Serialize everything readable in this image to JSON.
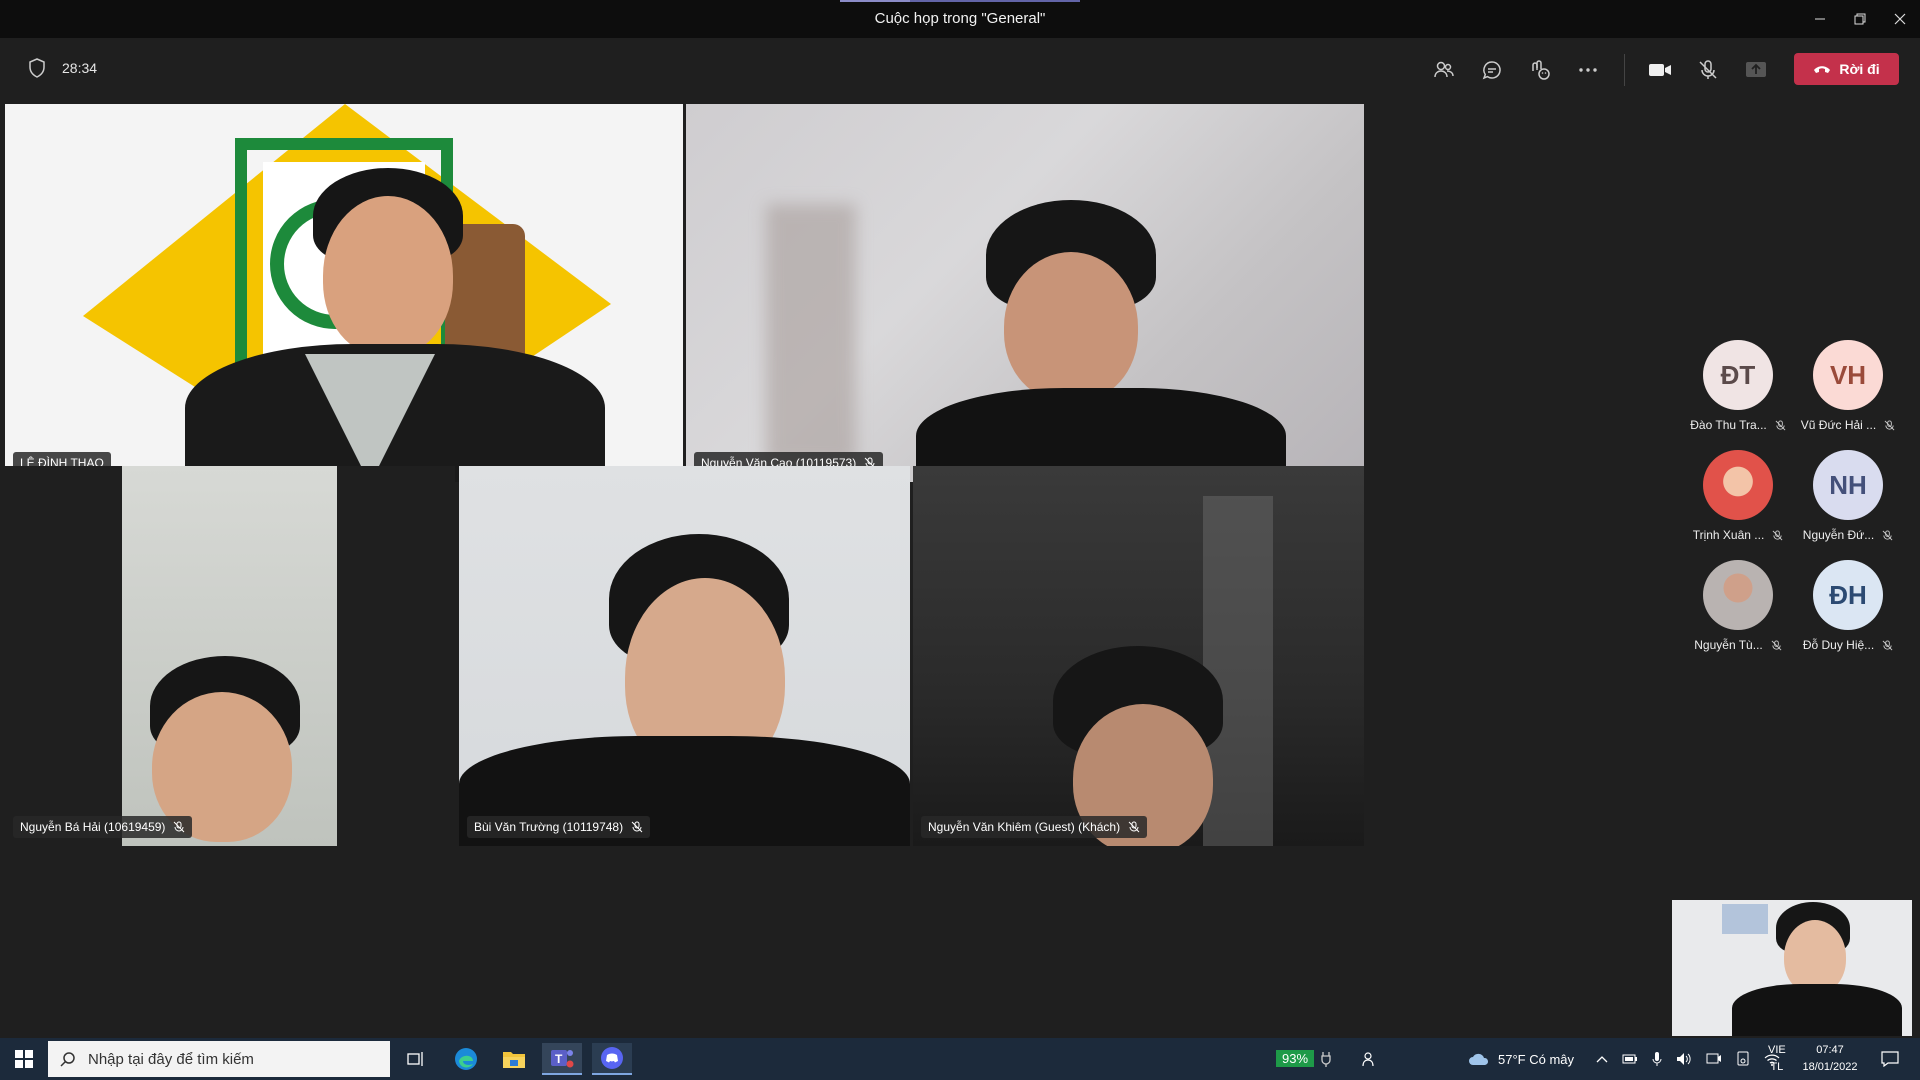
{
  "window": {
    "title": "Cuộc họp trong \"General\"",
    "controls": [
      "minimize",
      "restore",
      "close"
    ]
  },
  "meeting_bar": {
    "timer": "28:34",
    "leave_label": "Rời đi",
    "buttons": [
      "people-icon",
      "chat-icon",
      "reactions-icon",
      "more-icon",
      "camera-icon",
      "mic-off-icon",
      "share-icon"
    ]
  },
  "tiles": [
    {
      "name": "LÊ ĐÌNH THAO",
      "muted": false
    },
    {
      "name": "Nguyễn Văn Cao (10119573)",
      "muted": true
    },
    {
      "name": "Nguyễn Bá Hải (10619459)",
      "muted": true
    },
    {
      "name": "Bùi Văn Trường (10119748)",
      "muted": true
    },
    {
      "name": "Nguyễn Văn Khiêm (Guest) (Khách)",
      "muted": true
    }
  ],
  "roster": [
    {
      "initials": "ĐT",
      "name": "Đào Thu Tra...",
      "color": "#f0e4e4",
      "text_color": "#5b4a4a"
    },
    {
      "initials": "VH",
      "name": "Vũ Đức Hải ...",
      "color": "#fbdad5",
      "text_color": "#9a4a3a"
    },
    {
      "initials": "",
      "name": "Trịnh Xuân ...",
      "color": "#e77a6a",
      "text_color": "#ffffff"
    },
    {
      "initials": "NH",
      "name": "Nguyễn Đứ...",
      "color": "#d9dcef",
      "text_color": "#44507a"
    },
    {
      "initials": "",
      "name": "Nguyễn Tù...",
      "color": "#c9c3c0",
      "text_color": "#ffffff"
    },
    {
      "initials": "ĐH",
      "name": "Đỗ Duy Hiệ...",
      "color": "#dbe6f3",
      "text_color": "#2c4a72"
    }
  ],
  "taskbar": {
    "search_placeholder": "Nhập tại đây để tìm kiếm",
    "battery": "93%",
    "weather": "57°F  Có mây",
    "lang_top": "VIE",
    "lang_bottom": "TL",
    "time": "07:47",
    "date": "18/01/2022"
  }
}
